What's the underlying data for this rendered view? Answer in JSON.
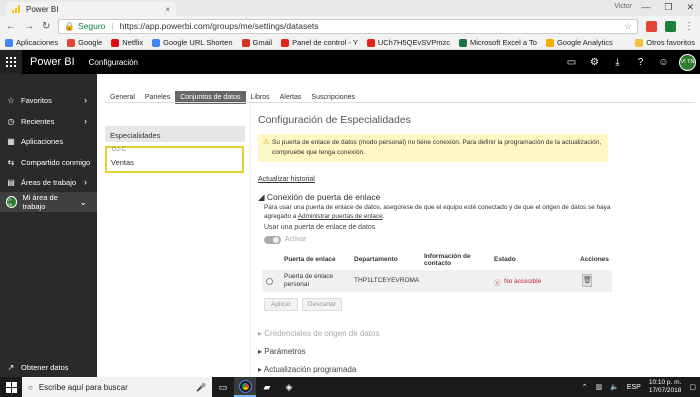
{
  "browser": {
    "tab_title": "Power BI",
    "tab_close": "×",
    "user_name": "Victor",
    "window_buttons": [
      "—",
      "❐",
      "✕"
    ],
    "secure_label": "Seguro",
    "url": "https://app.powerbi.com/groups/me/settings/datasets",
    "bookmarks": [
      {
        "label": "Aplicaciones",
        "color": "#4285f4"
      },
      {
        "label": "Google",
        "color": "#ea4335"
      },
      {
        "label": "Netflix",
        "color": "#e50914"
      },
      {
        "label": "Google URL Shorten",
        "color": "#4285f4"
      },
      {
        "label": "Gmail",
        "color": "#d93025"
      },
      {
        "label": "Panel de control - Y",
        "color": "#e62117"
      },
      {
        "label": "UCh7H5QEvSVPmzc",
        "color": "#e62117"
      },
      {
        "label": "Microsoft Excel a To",
        "color": "#1e7145"
      },
      {
        "label": "Google Analytics",
        "color": "#f9ab00"
      }
    ],
    "other_bookmarks": "Otros favoritos"
  },
  "app": {
    "brand": "Power BI",
    "section": "Configuración",
    "avatar_initials": "VI TN"
  },
  "nav": {
    "items": [
      {
        "label": "Favoritos",
        "icon": "☆",
        "chevron": "›"
      },
      {
        "label": "Recientes",
        "icon": "◷",
        "chevron": "›"
      },
      {
        "label": "Aplicaciones",
        "icon": "▦",
        "chevron": ""
      },
      {
        "label": "Compartido conmigo",
        "icon": "⇆",
        "chevron": ""
      },
      {
        "label": "Áreas de trabajo",
        "icon": "▤",
        "chevron": "›"
      },
      {
        "label": "Mi área de trabajo",
        "icon": "",
        "chevron": "⌄"
      }
    ],
    "get_data": "Obtener datos"
  },
  "tabs": [
    "General",
    "Paneles",
    "Conjuntos de datos",
    "Libros",
    "Alertas",
    "Suscripciones"
  ],
  "left_list": {
    "item_a": "Especialidades",
    "item_b": "GJ-C",
    "item_c": "Ventas"
  },
  "settings": {
    "title": "Configuración de Especialidades",
    "warning": "Su puerta de enlace de datos (modo personal) no tiene conexión. Para definir la programación de la actualización, compruebe que tenga conexión.",
    "history_link": "Actualizar historial",
    "gateway_heading": "◢ Conexión de puerta de enlace",
    "gateway_desc": "Para usar una puerta de enlace de datos, asegúrese de que el equipo esté conectado y de que el origen de datos se haya agregado a",
    "gateway_link": "Administrar puertas de enlace",
    "use_gateway": "Usar una puerta de enlace de datos",
    "activate": "Activar",
    "table_headers": {
      "gateway": "Puerta de enlace",
      "department": "Departamento",
      "contact": "Información de contacto",
      "status": "Estado",
      "actions": "Acciones"
    },
    "row": {
      "gateway": "Puerta de enlace personal",
      "department": "THP1LTCEYEVROMA",
      "status": "No accesible"
    },
    "apply": "Aplicar",
    "discard": "Descartar",
    "sections": [
      "Credenciales de origen de datos",
      "Parámetros",
      "Actualización programada"
    ]
  },
  "taskbar": {
    "search_placeholder": "Escribe aquí para buscar",
    "lang": "ESP",
    "time": "10:10 p. m.",
    "date": "17/07/2018"
  }
}
